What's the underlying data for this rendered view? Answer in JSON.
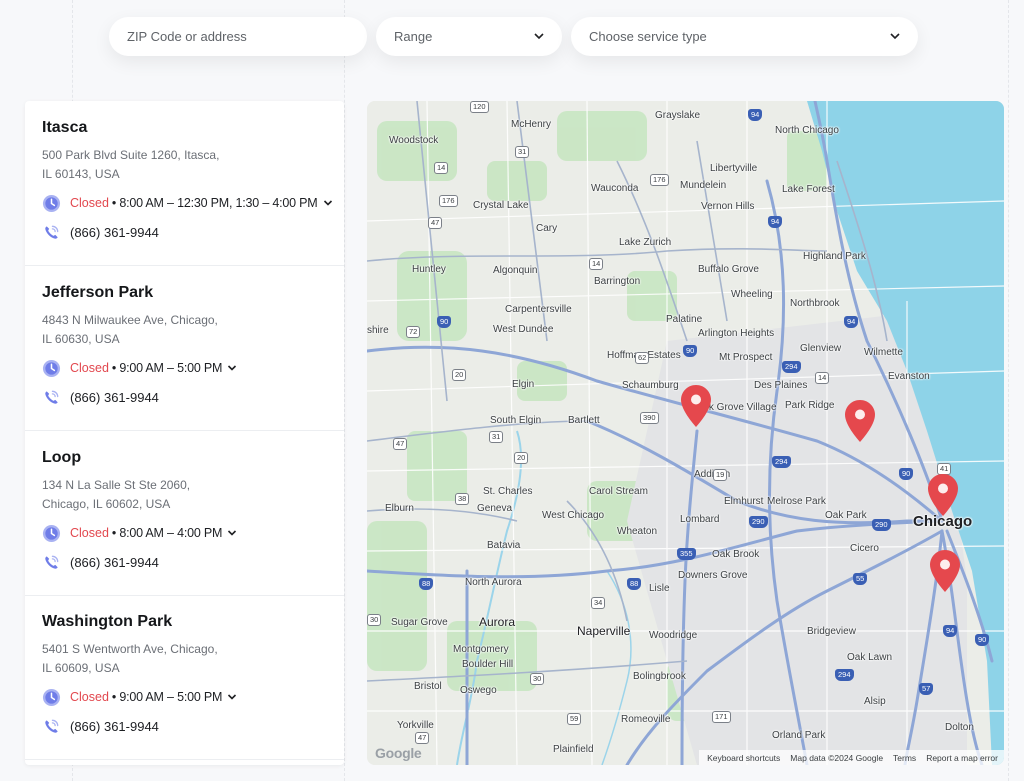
{
  "search": {
    "zip_placeholder": "ZIP Code or address",
    "range_placeholder": "Range",
    "service_placeholder": "Choose service type"
  },
  "locations": [
    {
      "name": "Itasca",
      "address_line1": "500 Park Blvd Suite 1260, Itasca,",
      "address_line2": "IL 60143, USA",
      "status": "Closed",
      "hours": "8:00 AM – 12:30 PM, 1:30 – 4:00 PM",
      "phone": "(866) 361-9944"
    },
    {
      "name": "Jefferson Park",
      "address_line1": "4843 N Milwaukee Ave, Chicago,",
      "address_line2": "IL 60630, USA",
      "status": "Closed",
      "hours": "9:00 AM – 5:00 PM",
      "phone": "(866) 361-9944"
    },
    {
      "name": "Loop",
      "address_line1": "134 N La Salle St Ste 2060,",
      "address_line2": "Chicago, IL 60602, USA",
      "status": "Closed",
      "hours": "8:00 AM – 4:00 PM",
      "phone": "(866) 361-9944"
    },
    {
      "name": "Washington Park",
      "address_line1": "5401 S Wentworth Ave, Chicago,",
      "address_line2": "IL 60609, USA",
      "status": "Closed",
      "hours": "9:00 AM – 5:00 PM",
      "phone": "(866) 361-9944"
    }
  ],
  "map": {
    "labels": {
      "chicago": "Chicago",
      "aurora": "Aurora",
      "naperville": "Naperville",
      "mchenry": "McHenry",
      "woodstock": "Woodstock",
      "grayslake": "Grayslake",
      "north_chicago": "North Chicago",
      "libertyville": "Libertyville",
      "mundelein": "Mundelein",
      "wauconda": "Wauconda",
      "crystal_lake": "Crystal Lake",
      "vernon_hills": "Vernon Hills",
      "lake_forest": "Lake Forest",
      "cary": "Cary",
      "lake_zurich": "Lake Zurich",
      "huntley": "Huntley",
      "algonquin": "Algonquin",
      "buffalo_grove": "Buffalo Grove",
      "barrington": "Barrington",
      "highland_park": "Highland Park",
      "wheeling": "Wheeling",
      "carpentersville": "Carpentersville",
      "northbrook": "Northbrook",
      "palatine": "Palatine",
      "west_dundee": "West Dundee",
      "arlington_heights": "Arlington Heights",
      "mt_prospect": "Mt Prospect",
      "glenview": "Glenview",
      "wilmette": "Wilmette",
      "hampshire": "shire",
      "hoffman_estates": "Hoffman Estates",
      "evanston": "Evanston",
      "schaumburg": "Schaumburg",
      "des_plaines": "Des Plaines",
      "elgin": "Elgin",
      "elk_grove": "Elk Grove Village",
      "park_ridge": "Park Ridge",
      "south_elgin": "South Elgin",
      "bartlett": "Bartlett",
      "addison": "Addison",
      "st_charles": "St. Charles",
      "carol_stream": "Carol Stream",
      "elmhurst": "Elmhurst",
      "melrose_park": "Melrose Park",
      "elburn": "Elburn",
      "geneva": "Geneva",
      "west_chicago": "West Chicago",
      "lombard": "Lombard",
      "oak_park": "Oak Park",
      "wheaton": "Wheaton",
      "batavia": "Batavia",
      "oak_brook": "Oak Brook",
      "cicero": "Cicero",
      "north_aurora": "North Aurora",
      "downers_grove": "Downers Grove",
      "lisle": "Lisle",
      "sugar_grove": "Sugar Grove",
      "woodridge": "Woodridge",
      "bridgeview": "Bridgeview",
      "montgomery": "Montgomery",
      "boulder_hill": "Boulder Hill",
      "oak_lawn": "Oak Lawn",
      "bristol": "Bristol",
      "oswego": "Oswego",
      "bolingbrook": "Bolingbrook",
      "alsip": "Alsip",
      "yorkville": "Yorkville",
      "romeoville": "Romeoville",
      "dolton": "Dolton",
      "orland_park": "Orland Park",
      "plainfield": "Plainfield"
    },
    "attribution": {
      "keyboard": "Keyboard shortcuts",
      "map_data": "Map data ©2024 Google",
      "terms": "Terms",
      "report": "Report a map error"
    },
    "google_logo": "Google"
  }
}
